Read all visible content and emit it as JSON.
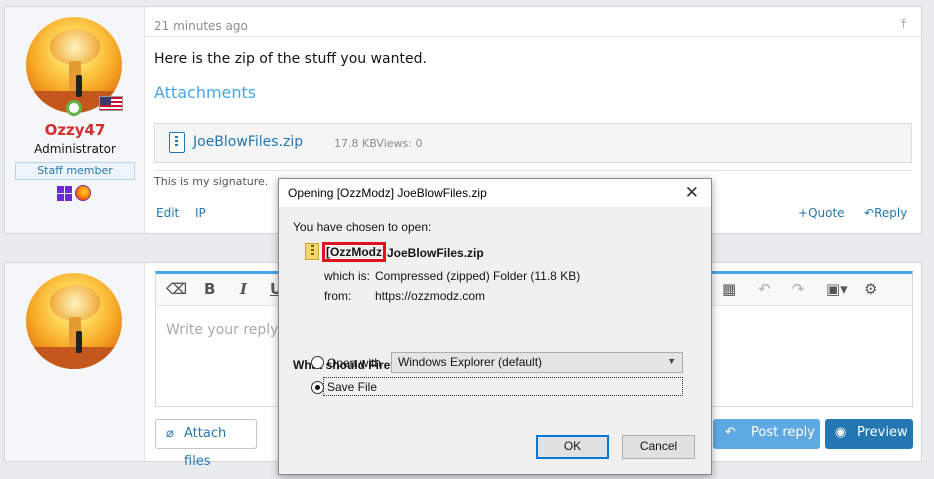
{
  "post1": {
    "username": "Ozzy47",
    "user_title": "Administrator",
    "badge": "Staff member",
    "time": "21 minutes ago",
    "body": "Here is the zip of the stuff you wanted.",
    "attachments_title": "Attachments",
    "attachment": {
      "name": "JoeBlowFiles.zip",
      "meta": "17.8 KBViews: 0"
    },
    "signature": "This is my signature.",
    "actions": {
      "edit": "Edit",
      "ip": "IP",
      "quote": "Quote",
      "reply": "Reply"
    }
  },
  "editor": {
    "placeholder": "Write your reply...",
    "attach_label": "Attach files",
    "post_label": "Post reply",
    "preview_label": "Preview"
  },
  "dialog": {
    "title": "Opening [OzzModz] JoeBlowFiles.zip",
    "chosen_label": "You have chosen to open:",
    "file_prefix": "[OzzModz",
    "file_rest": "JoeBlowFiles.zip",
    "which_is_label": "which is:",
    "which_is_value": "Compressed (zipped) Folder (11.8 KB)",
    "from_label": "from:",
    "from_value": "https://ozzmodz.com",
    "question": "What should Firefox do with this file?",
    "open_with_label": "Open with",
    "open_with_value": "Windows Explorer (default)",
    "save_file_label": "Save File",
    "selected_option": "save_file",
    "ok_label": "OK",
    "cancel_label": "Cancel"
  },
  "colors": {
    "username": "#d32f2f",
    "link": "#2577b1",
    "accent": "#47a7eb",
    "highlight_box": "#e0141e"
  }
}
